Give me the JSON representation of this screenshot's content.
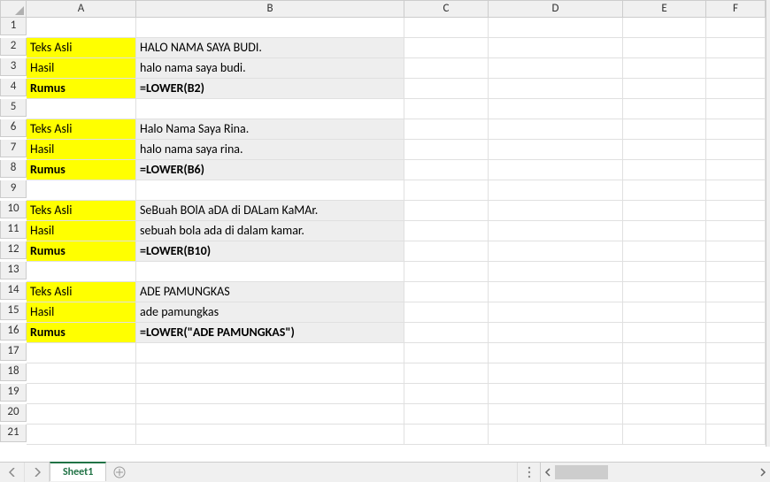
{
  "columns": [
    "A",
    "B",
    "C",
    "D",
    "E",
    "F"
  ],
  "rows": [
    "1",
    "2",
    "3",
    "4",
    "5",
    "6",
    "7",
    "8",
    "9",
    "10",
    "11",
    "12",
    "13",
    "14",
    "15",
    "16",
    "17",
    "18",
    "19",
    "20",
    "21"
  ],
  "cells": {
    "r2a": {
      "text": "Teks Asli",
      "yellow": true
    },
    "r2b": {
      "text": "HALO NAMA SAYA BUDI.",
      "shade": true
    },
    "r3a": {
      "text": "Hasil",
      "yellow": true
    },
    "r3b": {
      "text": "halo nama saya budi.",
      "shade": true
    },
    "r4a": {
      "text": "Rumus",
      "yellow": true,
      "bold": true
    },
    "r4b": {
      "text": "=LOWER(B2)",
      "shade": true,
      "bold": true
    },
    "r6a": {
      "text": "Teks Asli",
      "yellow": true
    },
    "r6b": {
      "text": "Halo Nama Saya Rina.",
      "shade": true
    },
    "r7a": {
      "text": "Hasil",
      "yellow": true
    },
    "r7b": {
      "text": "halo nama saya rina.",
      "shade": true
    },
    "r8a": {
      "text": "Rumus",
      "yellow": true,
      "bold": true
    },
    "r8b": {
      "text": "=LOWER(B6)",
      "shade": true,
      "bold": true
    },
    "r10a": {
      "text": "Teks Asli",
      "yellow": true
    },
    "r10b": {
      "text": "SeBuah BOlA aDA di DALam KaMAr.",
      "shade": true
    },
    "r11a": {
      "text": "Hasil",
      "yellow": true
    },
    "r11b": {
      "text": "sebuah bola ada di dalam kamar.",
      "shade": true
    },
    "r12a": {
      "text": "Rumus",
      "yellow": true,
      "bold": true
    },
    "r12b": {
      "text": "=LOWER(B10)",
      "shade": true,
      "bold": true
    },
    "r14a": {
      "text": "Teks Asli",
      "yellow": true
    },
    "r14b": {
      "text": "ADE PAMUNGKAS",
      "shade": true
    },
    "r15a": {
      "text": "Hasil",
      "yellow": true
    },
    "r15b": {
      "text": "ade pamungkas",
      "shade": true
    },
    "r16a": {
      "text": "Rumus",
      "yellow": true,
      "bold": true
    },
    "r16b": {
      "text": "=LOWER(\"ADE PAMUNGKAS\")",
      "shade": true,
      "bold": true
    }
  },
  "sheet": {
    "name": "Sheet1"
  }
}
